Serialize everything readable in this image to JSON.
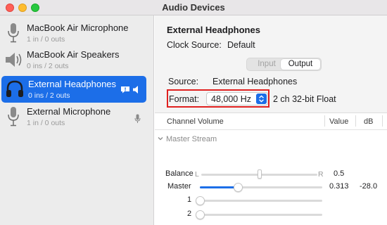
{
  "window": {
    "title": "Audio Devices"
  },
  "devices": [
    {
      "name": "MacBook Air Microphone",
      "io": "1 in / 0 outs",
      "icon": "microphone-icon",
      "selected": false
    },
    {
      "name": "MacBook Air Speakers",
      "io": "0 ins / 2 outs",
      "icon": "speaker-icon",
      "selected": false
    },
    {
      "name": "External Headphones",
      "io": "0 ins / 2 outs",
      "icon": "headphones-icon",
      "selected": true,
      "badges": [
        "alert-icon",
        "output-default-icon"
      ]
    },
    {
      "name": "External Microphone",
      "io": "1 in / 0 outs",
      "icon": "microphone-icon",
      "selected": false,
      "badges": [
        "input-default-mic-icon"
      ]
    }
  ],
  "detail": {
    "title": "External Headphones",
    "clock_label": "Clock Source:",
    "clock_value": "Default",
    "tabs": {
      "input": "Input",
      "output": "Output",
      "active": "Output"
    },
    "source_label": "Source:",
    "source_value": "External Headphones",
    "format_label": "Format:",
    "format_value": "48,000 Hz",
    "format_desc": "2 ch 32-bit Float"
  },
  "table": {
    "columns": [
      "Channel Volume",
      "Value",
      "dB"
    ],
    "group": "Master Stream",
    "rows": [
      {
        "label": "Balance",
        "left": "L",
        "right": "R",
        "value": "0.5",
        "db": "",
        "level": 0.5
      },
      {
        "label": "Master",
        "value": "0.313",
        "db": "-28.0",
        "level": 0.313
      },
      {
        "label": "1",
        "value": "",
        "db": "",
        "level": 0
      },
      {
        "label": "2",
        "value": "",
        "db": "",
        "level": 0
      }
    ]
  },
  "colors": {
    "accent": "#1c6ee8",
    "highlight_box": "#e0201f",
    "sidebar_bg": "#ececec"
  }
}
